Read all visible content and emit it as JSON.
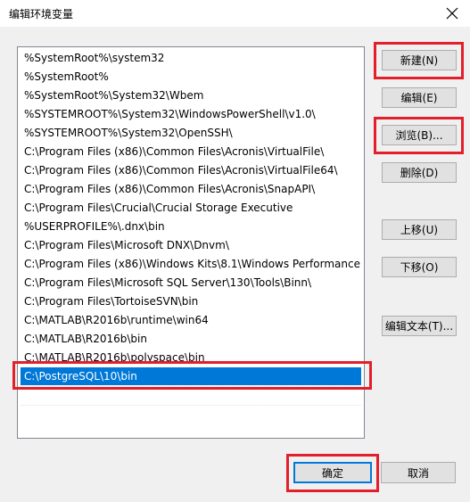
{
  "window": {
    "title": "编辑环境变量"
  },
  "list": {
    "items": [
      "%SystemRoot%\\system32",
      "%SystemRoot%",
      "%SystemRoot%\\System32\\Wbem",
      "%SYSTEMROOT%\\System32\\WindowsPowerShell\\v1.0\\",
      "%SYSTEMROOT%\\System32\\OpenSSH\\",
      "C:\\Program Files (x86)\\Common Files\\Acronis\\VirtualFile\\",
      "C:\\Program Files (x86)\\Common Files\\Acronis\\VirtualFile64\\",
      "C:\\Program Files (x86)\\Common Files\\Acronis\\SnapAPI\\",
      "C:\\Program Files\\Crucial\\Crucial Storage Executive",
      "%USERPROFILE%\\.dnx\\bin",
      "C:\\Program Files\\Microsoft DNX\\Dnvm\\",
      "C:\\Program Files (x86)\\Windows Kits\\8.1\\Windows Performance...",
      "C:\\Program Files\\Microsoft SQL Server\\130\\Tools\\Binn\\",
      "C:\\Program Files\\TortoiseSVN\\bin",
      "C:\\MATLAB\\R2016b\\runtime\\win64",
      "C:\\MATLAB\\R2016b\\bin",
      "C:\\MATLAB\\R2016b\\polyspace\\bin",
      "C:\\PostgreSQL\\10\\bin"
    ],
    "selected_index": 17
  },
  "buttons": {
    "new": "新建(N)",
    "edit": "编辑(E)",
    "browse": "浏览(B)...",
    "delete": "删除(D)",
    "move_up": "上移(U)",
    "move_down": "下移(O)",
    "edit_text": "编辑文本(T)...",
    "ok": "确定",
    "cancel": "取消"
  },
  "colors": {
    "highlight": "#e21f2a",
    "selection": "#0078d7"
  }
}
